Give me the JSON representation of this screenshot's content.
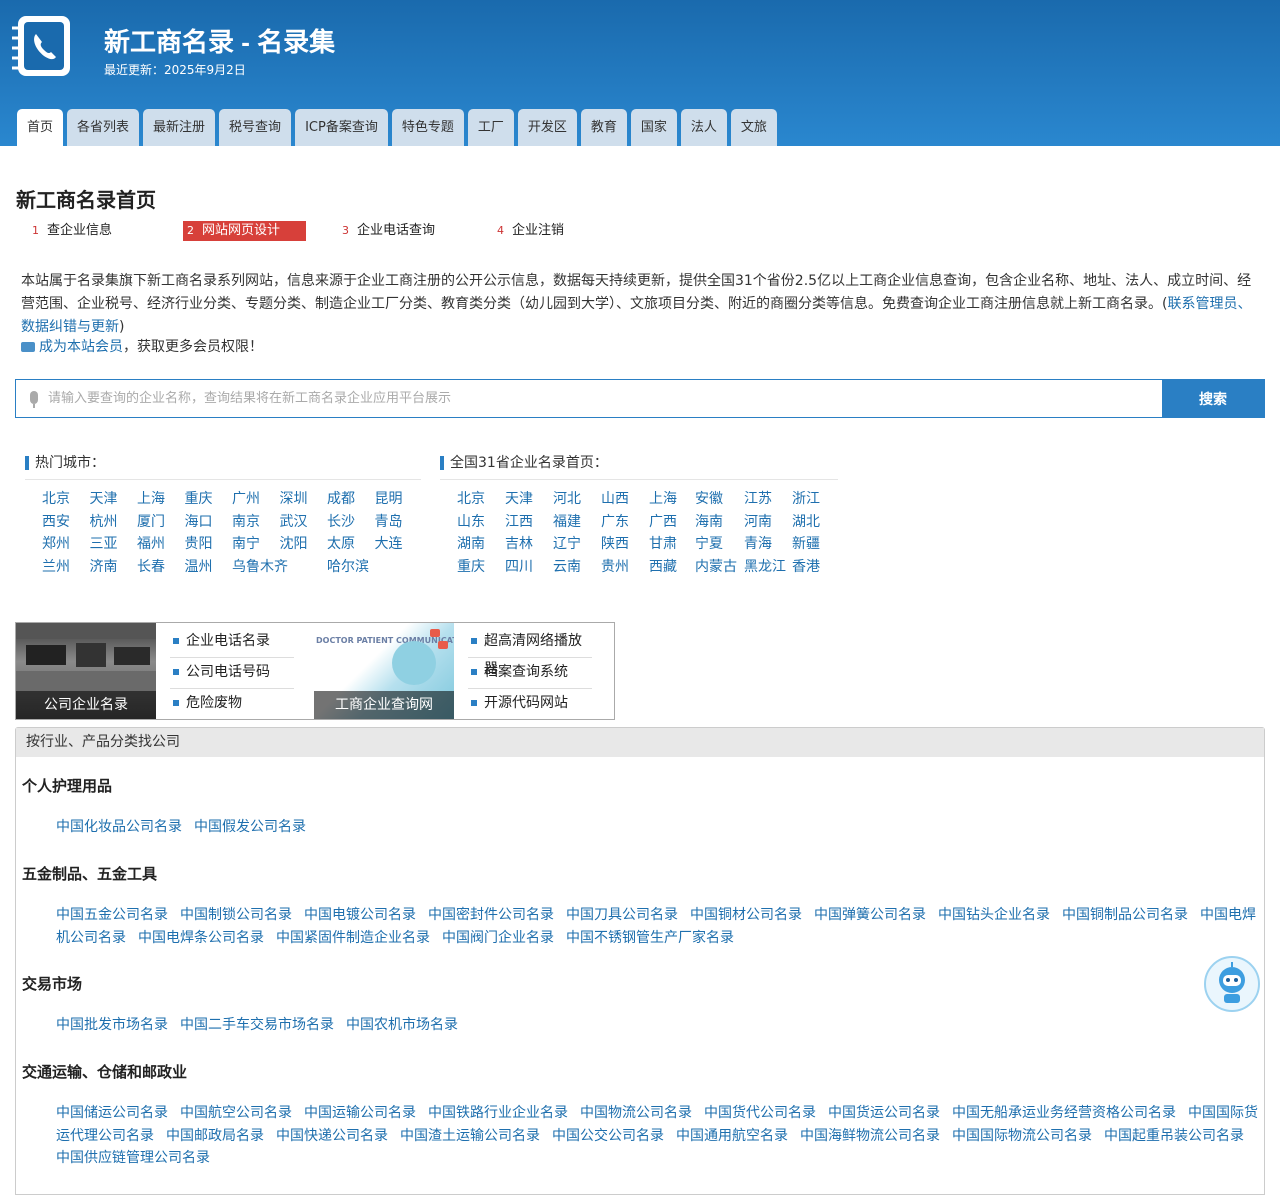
{
  "header": {
    "title": "新工商名录 - 名录集",
    "updated": "最近更新：2025年9月2日",
    "logo_icon": "phone-book-icon"
  },
  "nav": [
    "首页",
    "各省列表",
    "最新注册",
    "税号查询",
    "ICP备案查询",
    "特色专题",
    "工厂",
    "开发区",
    "教育",
    "国家",
    "法人",
    "文旅"
  ],
  "page_heading": "新工商名录首页",
  "steps": [
    {
      "num": "1",
      "label": "查企业信息"
    },
    {
      "num": "2",
      "label": "网站网页设计"
    },
    {
      "num": "3",
      "label": "企业电话查询"
    },
    {
      "num": "4",
      "label": "企业注销"
    }
  ],
  "intro": {
    "text": "本站属于名录集旗下新工商名录系列网站，信息来源于企业工商注册的公开公示信息，数据每天持续更新，提供全国31个省份2.5亿以上工商企业信息查询，包含企业名称、地址、法人、成立时间、经营范围、企业税号、经济行业分类、专题分类、制造企业工厂分类、教育类分类（幼儿园到大学）、文旅项目分类、附近的商圈分类等信息。免费查询企业工商注册信息就上新工商名录。(",
    "link": "联系管理员、数据纠错与更新",
    "close": ")"
  },
  "member": {
    "link": "成为本站会员",
    "text": "，获取更多会员权限！"
  },
  "search": {
    "placeholder": "请输入要查询的企业名称，查询结果将在新工商名录企业应用平台展示",
    "button": "搜索"
  },
  "hot_cities": {
    "title": "热门城市：",
    "items": [
      "北京",
      "天津",
      "上海",
      "重庆",
      "广州",
      "深圳",
      "成都",
      "昆明",
      "西安",
      "杭州",
      "厦门",
      "海口",
      "南京",
      "武汉",
      "长沙",
      "青岛",
      "郑州",
      "三亚",
      "福州",
      "贵阳",
      "南宁",
      "沈阳",
      "太原",
      "大连",
      "兰州",
      "济南",
      "长春",
      "温州",
      "乌鲁木齐",
      "哈尔滨"
    ]
  },
  "provinces": {
    "title": "全国31省企业名录首页：",
    "items": [
      "北京",
      "天津",
      "河北",
      "山西",
      "上海",
      "安徽",
      "江苏",
      "浙江",
      "山东",
      "江西",
      "福建",
      "广东",
      "广西",
      "海南",
      "河南",
      "湖北",
      "湖南",
      "吉林",
      "辽宁",
      "陕西",
      "甘肃",
      "宁夏",
      "青海",
      "新疆",
      "重庆",
      "四川",
      "云南",
      "贵州",
      "西藏",
      "内蒙古",
      "黑龙江",
      "香港"
    ]
  },
  "promo": {
    "img1_caption": "公司企业名录",
    "list1": [
      "企业电话名录",
      "公司电话号码",
      "危险废物"
    ],
    "img2_caption": "工商企业查询网",
    "img2_text": "DOCTOR PATIENT COMMUNICATION",
    "list2": [
      "超高清网络播放器",
      "档案查询系统",
      "开源代码网站"
    ]
  },
  "industry": {
    "header": "按行业、产品分类找公司",
    "categories": [
      {
        "title": "个人护理用品",
        "links": [
          "中国化妆品公司名录",
          "中国假发公司名录"
        ]
      },
      {
        "title": "五金制品、五金工具",
        "links": [
          "中国五金公司名录",
          "中国制锁公司名录",
          "中国电镀公司名录",
          "中国密封件公司名录",
          "中国刀具公司名录",
          "中国铜材公司名录",
          "中国弹簧公司名录",
          "中国钻头企业名录",
          "中国铜制品公司名录",
          "中国电焊机公司名录",
          "中国电焊条公司名录",
          "中国紧固件制造企业名录",
          "中国阀门企业名录",
          "中国不锈钢管生产厂家名录"
        ]
      },
      {
        "title": "交易市场",
        "links": [
          "中国批发市场名录",
          "中国二手车交易市场名录",
          "中国农机市场名录"
        ]
      },
      {
        "title": "交通运输、仓储和邮政业",
        "links": [
          "中国储运公司名录",
          "中国航空公司名录",
          "中国运输公司名录",
          "中国铁路行业企业名录",
          "中国物流公司名录",
          "中国货代公司名录",
          "中国货运公司名录",
          "中国无船承运业务经营资格公司名录",
          "中国国际货运代理公司名录",
          "中国邮政局名录",
          "中国快递公司名录",
          "中国渣土运输公司名录",
          "中国公交公司名录",
          "中国通用航空名录",
          "中国海鲜物流公司名录",
          "中国国际物流公司名录",
          "中国起重吊装公司名录",
          "中国供应链管理公司名录"
        ]
      }
    ]
  },
  "robot_icon": "robot-assistant-icon"
}
